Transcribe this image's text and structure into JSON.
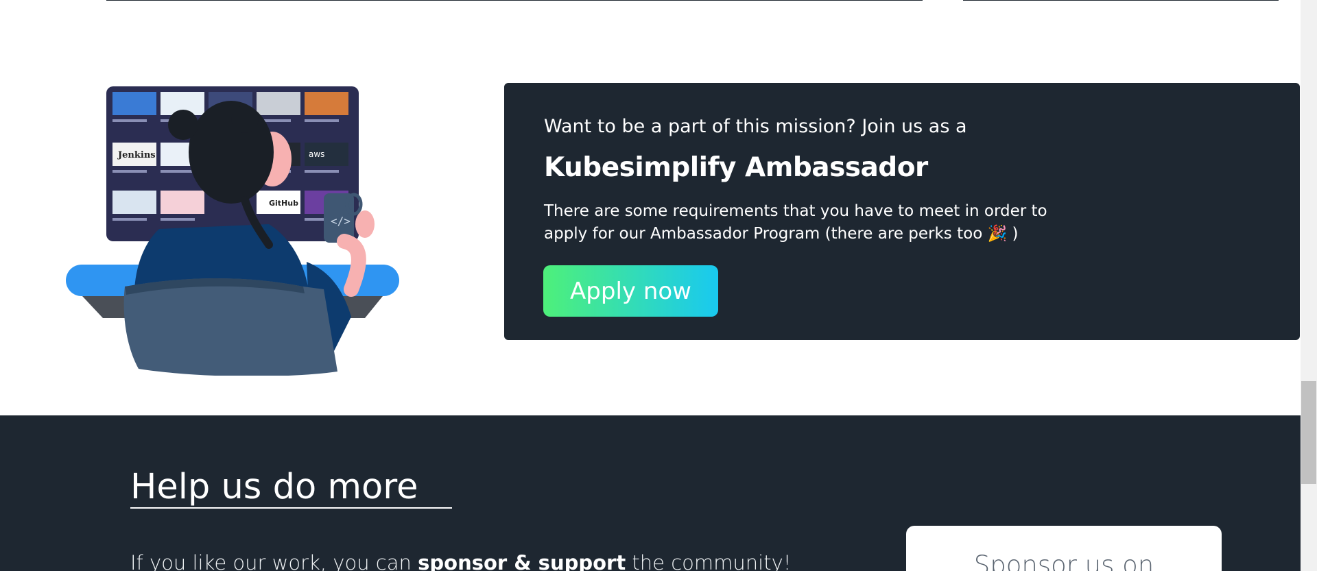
{
  "ambassador": {
    "intro": "Want to be a part of this mission? Join us as a",
    "title": "Kubesimplify Ambassador",
    "description": "There are some requirements that you have to meet in order to apply for our Ambassador Program (there are perks too 🎉 )",
    "apply_label": "Apply now"
  },
  "illustration": {
    "tiles": [
      "Jenkins",
      "aws",
      "GitHub"
    ],
    "mug_icon": "code-icon"
  },
  "help": {
    "heading": "Help us do more",
    "text_prefix": "If you like our work, you can ",
    "text_bold": "sponsor & support",
    "text_suffix": " the community!",
    "sponsor_label": "Sponsor us on"
  },
  "colors": {
    "dark": "#1e2731",
    "accent_start": "#4ef07a",
    "accent_end": "#19c9f0"
  }
}
